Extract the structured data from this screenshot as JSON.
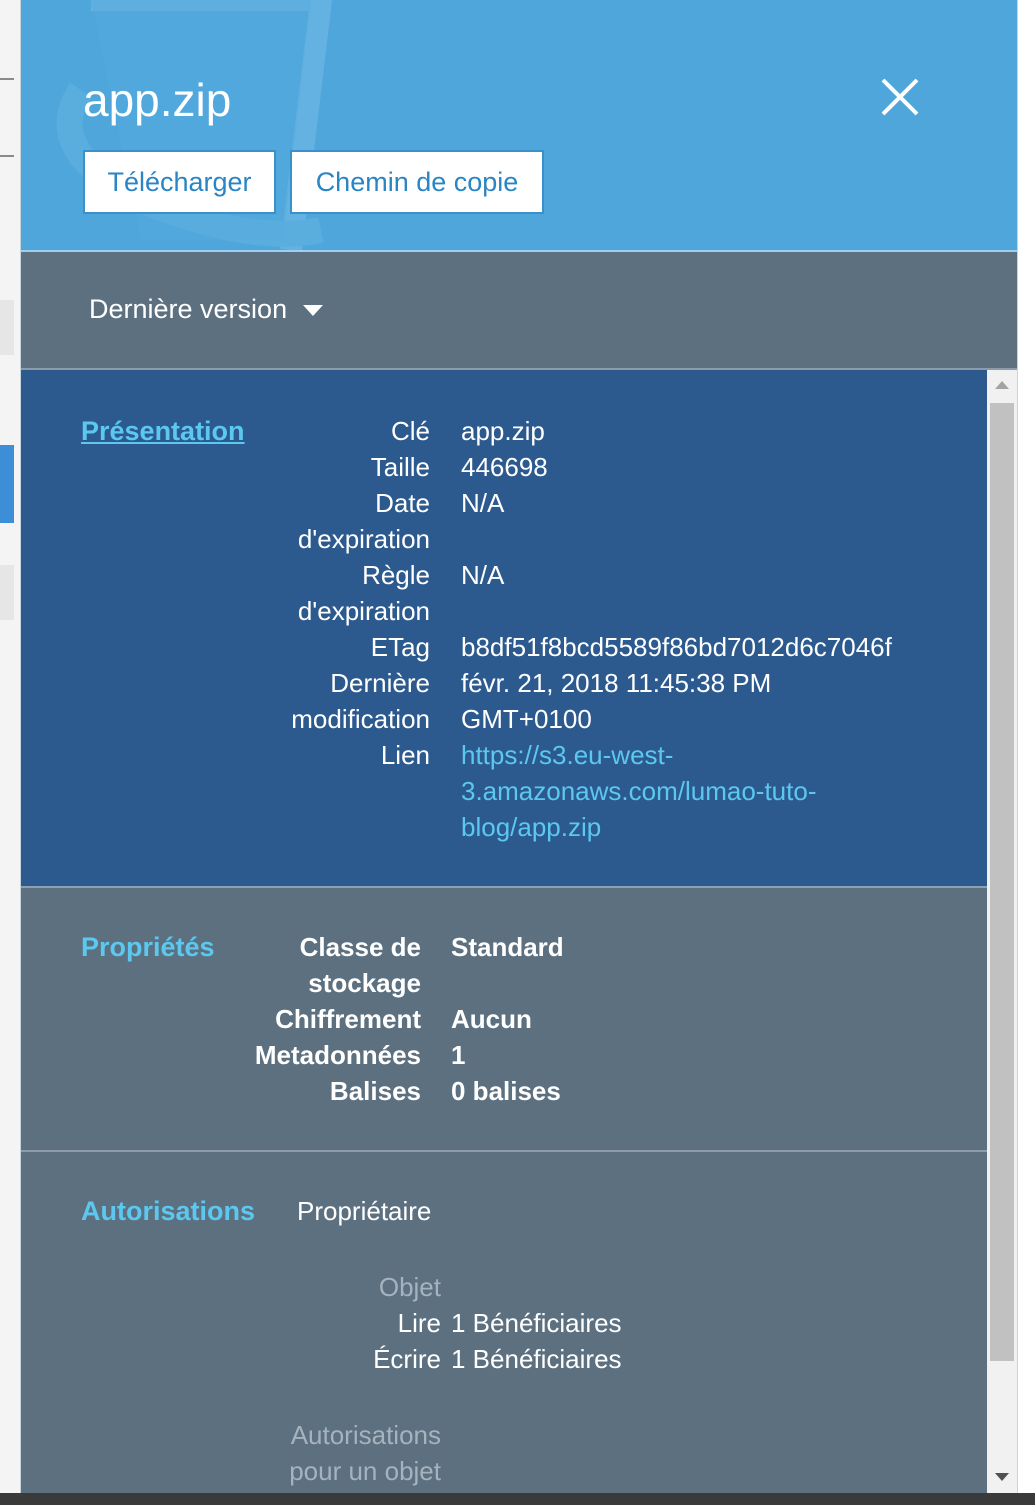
{
  "header": {
    "title": "app.zip",
    "download_label": "Télécharger",
    "copy_path_label": "Chemin de copie"
  },
  "version": {
    "label": "Dernière version"
  },
  "overview": {
    "title": "Présentation",
    "fields": [
      {
        "key": "Clé",
        "value": "app.zip"
      },
      {
        "key": "Taille",
        "value": "446698"
      },
      {
        "key_line1": "Date",
        "key_line2": "d'expiration",
        "value": "N/A"
      },
      {
        "key_line1": "Règle",
        "key_line2": "d'expiration",
        "value": "N/A"
      },
      {
        "key": "ETag",
        "value": "b8df51f8bcd5589f86bd7012d6c7046f"
      },
      {
        "key_line1": "Dernière",
        "key_line2": "modification",
        "value_line1": "févr. 21, 2018 11:45:38 PM",
        "value_line2": "GMT+0100"
      },
      {
        "key": "Lien",
        "value_line1": "https://s3.eu-west-",
        "value_line2": "3.amazonaws.com/lumao-tuto-",
        "value_line3": "blog/app.zip"
      }
    ]
  },
  "properties": {
    "title": "Propriétés",
    "fields": [
      {
        "key_line1": "Classe de",
        "key_line2": "stockage",
        "value": "Standard"
      },
      {
        "key": "Chiffrement",
        "value": "Aucun"
      },
      {
        "key": "Metadonnées",
        "value": "1"
      },
      {
        "key": "Balises",
        "value": "0 balises"
      }
    ]
  },
  "permissions": {
    "title": "Autorisations",
    "owner_label": "Propriétaire",
    "object_heading": "Objet",
    "rows": [
      {
        "key": "Lire",
        "value": "1 Bénéficiaires"
      },
      {
        "key": "Écrire",
        "value": "1 Bénéficiaires"
      }
    ],
    "object_perms_heading_line1": "Autorisations",
    "object_perms_heading_line2": "pour un objet"
  }
}
